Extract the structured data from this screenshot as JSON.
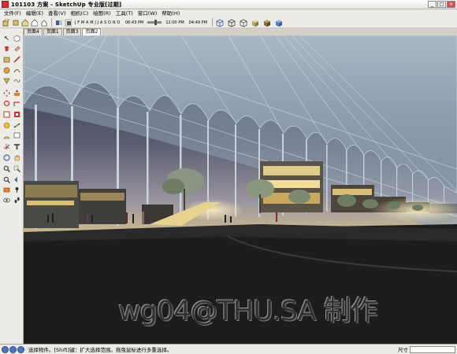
{
  "window": {
    "title": "101103 方案 - SketchUp 专业版[过期]",
    "buttons": [
      "_",
      "□",
      "×"
    ]
  },
  "menu": {
    "items": [
      "文件(F)",
      "编辑(E)",
      "查看(V)",
      "相机(C)",
      "绘图(R)",
      "工具(T)",
      "窗口(W)",
      "帮助(H)"
    ]
  },
  "toolbar": {
    "months": [
      "J",
      "F",
      "M",
      "A",
      "M",
      "J",
      "J",
      "A",
      "S",
      "O",
      "N",
      "D"
    ],
    "time_start": "06:43 PM",
    "time_noon": "12:00 PM",
    "time_end": "04:49 PM"
  },
  "scenes": {
    "tabs": [
      "页面4",
      "页面1",
      "页面3",
      "页面2"
    ],
    "active_index": 3
  },
  "viewport": {
    "watermark": "wg04@THU.SA 制作"
  },
  "statusbar": {
    "text": "选择物件。[Shift]键：扩大选择范围。拖曳鼠标进行多重选择。",
    "measure_label": "尺寸",
    "measure_value": ""
  },
  "colors": {
    "sky_top": "#3a3e57",
    "sky_bottom": "#8a8a9a",
    "ground": "#1f1f1f",
    "canopy": "#9fb4c4",
    "accent_light": "#f2e2a6"
  }
}
